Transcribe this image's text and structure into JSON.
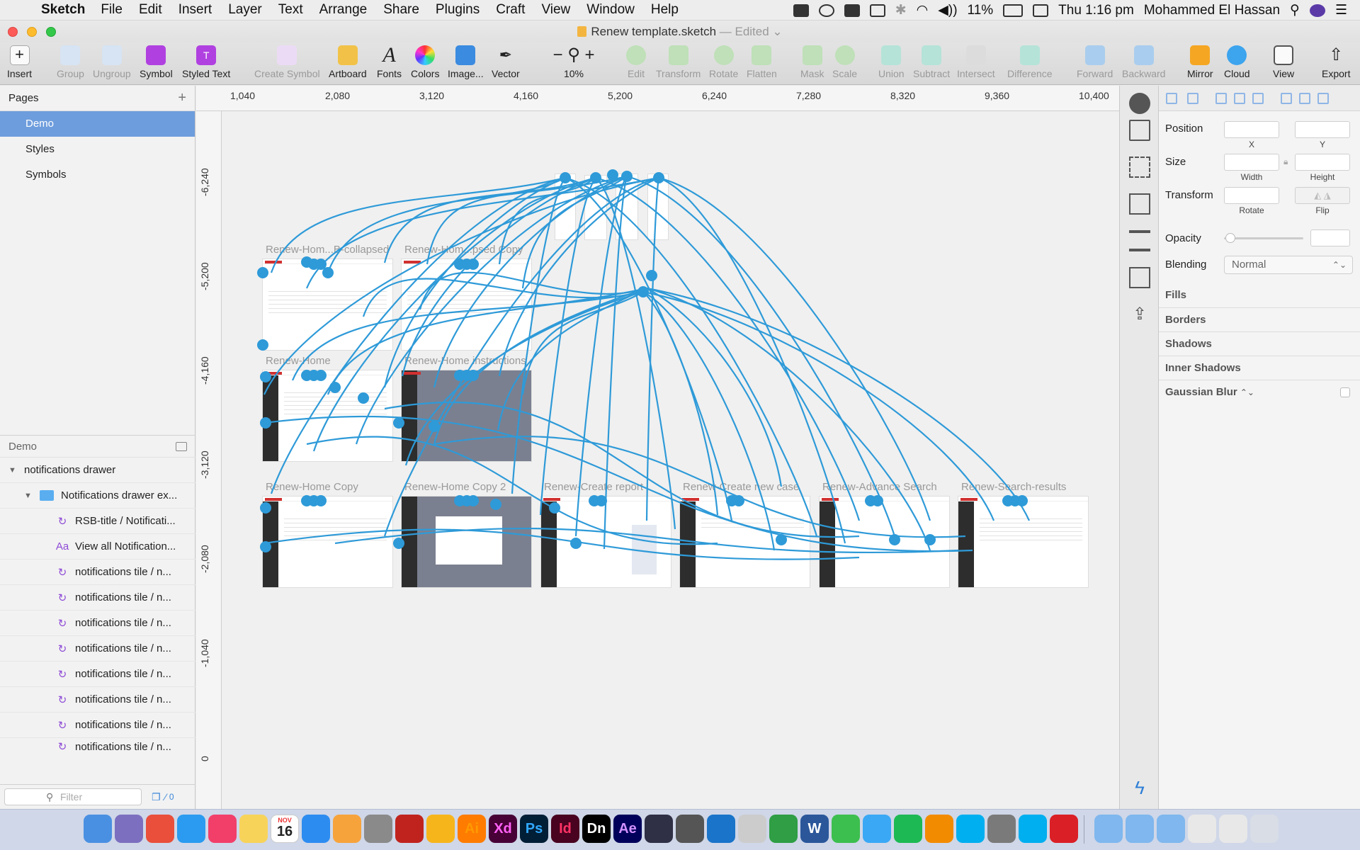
{
  "menubar": {
    "app": "Sketch",
    "items": [
      "File",
      "Edit",
      "Insert",
      "Layer",
      "Text",
      "Arrange",
      "Share",
      "Plugins",
      "Craft",
      "View",
      "Window",
      "Help"
    ],
    "battery": "11%",
    "clock": "Thu 1:16 pm",
    "user": "Mohammed El Hassan"
  },
  "window": {
    "title": "Renew template.sketch",
    "status": "— Edited"
  },
  "toolbar": {
    "insert": "Insert",
    "group": "Group",
    "ungroup": "Ungroup",
    "symbol": "Symbol",
    "styled_text": "Styled Text",
    "create_symbol": "Create Symbol",
    "artboard": "Artboard",
    "fonts": "Fonts",
    "colors": "Colors",
    "image": "Image...",
    "vector": "Vector",
    "zoom": "10%",
    "edit": "Edit",
    "transform": "Transform",
    "rotate": "Rotate",
    "flatten": "Flatten",
    "mask": "Mask",
    "scale": "Scale",
    "union": "Union",
    "subtract": "Subtract",
    "intersect": "Intersect",
    "difference": "Difference",
    "forward": "Forward",
    "backward": "Backward",
    "mirror": "Mirror",
    "cloud": "Cloud",
    "view": "View",
    "export": "Export"
  },
  "pages": {
    "header": "Pages",
    "items": [
      "Demo",
      "Styles",
      "Symbols"
    ]
  },
  "layers": {
    "header": "Demo",
    "items": [
      {
        "label": "notifications drawer",
        "icon": "group"
      },
      {
        "label": "Notifications drawer ex...",
        "icon": "folder"
      },
      {
        "label": "RSB-title / Notificati...",
        "icon": "symbol"
      },
      {
        "label": "View all Notification...",
        "icon": "text"
      },
      {
        "label": "notifications tile / n...",
        "icon": "symbol"
      },
      {
        "label": "notifications tile / n...",
        "icon": "symbol"
      },
      {
        "label": "notifications tile / n...",
        "icon": "symbol"
      },
      {
        "label": "notifications tile / n...",
        "icon": "symbol"
      },
      {
        "label": "notifications tile / n...",
        "icon": "symbol"
      },
      {
        "label": "notifications tile / n...",
        "icon": "symbol"
      },
      {
        "label": "notifications tile / n...",
        "icon": "symbol"
      },
      {
        "label": "notifications tile / n...",
        "icon": "symbol"
      }
    ],
    "filter_placeholder": "Filter",
    "filter_count": "0"
  },
  "rulers": {
    "horizontal": [
      "1,040",
      "2,080",
      "3,120",
      "4,160",
      "5,200",
      "6,240",
      "7,280",
      "8,320",
      "9,360",
      "10,400"
    ],
    "vertical": [
      "-6,240",
      "-5,200",
      "-4,160",
      "-3,120",
      "-2,080",
      "-1,040",
      "0"
    ]
  },
  "artboards": [
    "Renew-Hom...B-collapsed",
    "Renew-Hom...psed Copy",
    "Renew-Home",
    "Renew-Home instructions",
    "Renew-Home Copy",
    "Renew-Home Copy 2",
    "Renew-Create report",
    "Renew-Create new case",
    "Renew-Advance Search",
    "Renew-Search-results"
  ],
  "inspector": {
    "position": "Position",
    "x": "X",
    "y": "Y",
    "size": "Size",
    "width": "Width",
    "height": "Height",
    "transform": "Transform",
    "rotate": "Rotate",
    "flip": "Flip",
    "opacity": "Opacity",
    "blending": "Blending",
    "blending_value": "Normal",
    "sections": [
      "Fills",
      "Borders",
      "Shadows",
      "Inner Shadows",
      "Gaussian Blur"
    ]
  },
  "colors": {
    "link": "#2e9ad8",
    "selection": "#6d9ddd",
    "symbol": "#8e4bd6"
  },
  "dock": {
    "apps": [
      "Finder",
      "Preview",
      "Chrome",
      "Safari",
      "Music",
      "Notes",
      "Calendar",
      "App Store",
      "Photos",
      "System Preferences",
      "Acrobat",
      "Sketch",
      "Ai",
      "Xd",
      "Ps",
      "Id",
      "Dn",
      "Ae",
      "Premiere Rush",
      "Sketch Mirror",
      "QuickTime",
      "TextEdit",
      "Xcode",
      "Word",
      "FaceTime",
      "Messages",
      "Spotify",
      "Sublime",
      "Skype",
      "Rocket",
      "Skype",
      "Creative Cloud"
    ],
    "calendar_month": "NOV",
    "calendar_day": "16"
  }
}
